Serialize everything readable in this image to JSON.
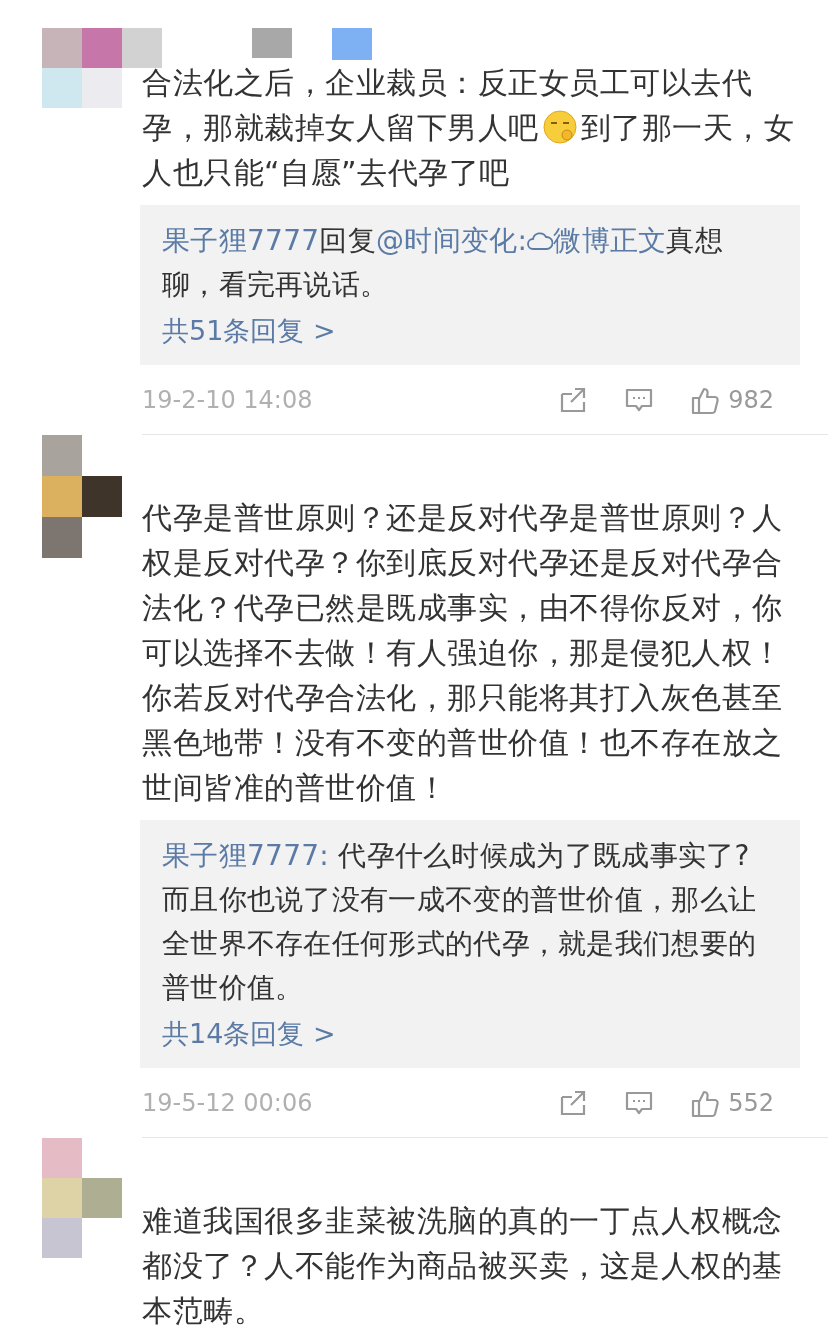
{
  "comments": [
    {
      "content": [
        {
          "kind": "text",
          "text": "合法化之后，企业裁员：反正女员工可以去代孕，那就裁掉女人留下男人吧"
        },
        {
          "kind": "emoji"
        },
        {
          "kind": "text",
          "text": "到了那一天，女人也只能“自愿”去代孕了吧"
        }
      ],
      "reply_box": {
        "replies": [
          [
            {
              "kind": "user",
              "text": "果子狸7777"
            },
            {
              "kind": "text",
              "text": "回复"
            },
            {
              "kind": "user",
              "text": "@时间变化:"
            },
            {
              "kind": "link",
              "text": "微博正文"
            },
            {
              "kind": "text",
              "text": "真想聊，看完再说话。"
            }
          ]
        ],
        "more": "共51条回复 >"
      },
      "time": "19-2-10 14:08",
      "likes": "982"
    },
    {
      "content": [
        {
          "kind": "text",
          "text": "代孕是普世原则？还是反对代孕是普世原则？人权是反对代孕？你到底反对代孕还是反对代孕合法化？代孕已然是既成事实，由不得你反对，你可以选择不去做！有人强迫你，那是侵犯人权！你若反对代孕合法化，那只能将其打入灰色甚至黑色地带！没有不变的普世价值！也不存在放之世间皆准的普世价值！"
        }
      ],
      "reply_box": {
        "replies": [
          [
            {
              "kind": "user",
              "text": "果子狸7777:"
            },
            {
              "kind": "text",
              "text": " 代孕什么时候成为了既成事实了?而且你也说了没有一成不变的普世价值，那么让全世界不存在任何形式的代孕，就是我们想要的普世价值。"
            }
          ]
        ],
        "more": "共14条回复 >"
      },
      "time": "19-5-12 00:06",
      "likes": "552"
    },
    {
      "content": [
        {
          "kind": "text",
          "text": "难道我国很多韭菜被洗脑的真的一丁点人权概念都没了？人不能作为商品被买卖，这是人权的基本范畴。"
        }
      ]
    }
  ]
}
